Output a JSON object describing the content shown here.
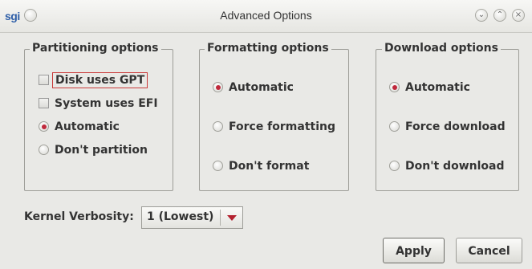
{
  "window": {
    "logo": "sgi",
    "title": "Advanced Options"
  },
  "partitioning": {
    "title": "Partitioning options",
    "options": [
      {
        "label": "Disk uses GPT",
        "kind": "checkbox",
        "checked": false,
        "focused": true
      },
      {
        "label": "System uses EFI",
        "kind": "checkbox",
        "checked": false
      },
      {
        "label": "Automatic",
        "kind": "radio",
        "selected": true
      },
      {
        "label": "Don't partition",
        "kind": "radio",
        "selected": false
      }
    ]
  },
  "formatting": {
    "title": "Formatting options",
    "options": [
      {
        "label": "Automatic",
        "selected": true
      },
      {
        "label": "Force formatting",
        "selected": false
      },
      {
        "label": "Don't format",
        "selected": false
      }
    ]
  },
  "download": {
    "title": "Download options",
    "options": [
      {
        "label": "Automatic",
        "selected": true
      },
      {
        "label": "Force download",
        "selected": false
      },
      {
        "label": "Don't download",
        "selected": false
      }
    ]
  },
  "kernel": {
    "label": "Kernel Verbosity:",
    "value": "1 (Lowest)"
  },
  "buttons": {
    "apply": "Apply",
    "cancel": "Cancel"
  },
  "colors": {
    "accent_red": "#c0283b",
    "background": "#e9e9e6"
  }
}
